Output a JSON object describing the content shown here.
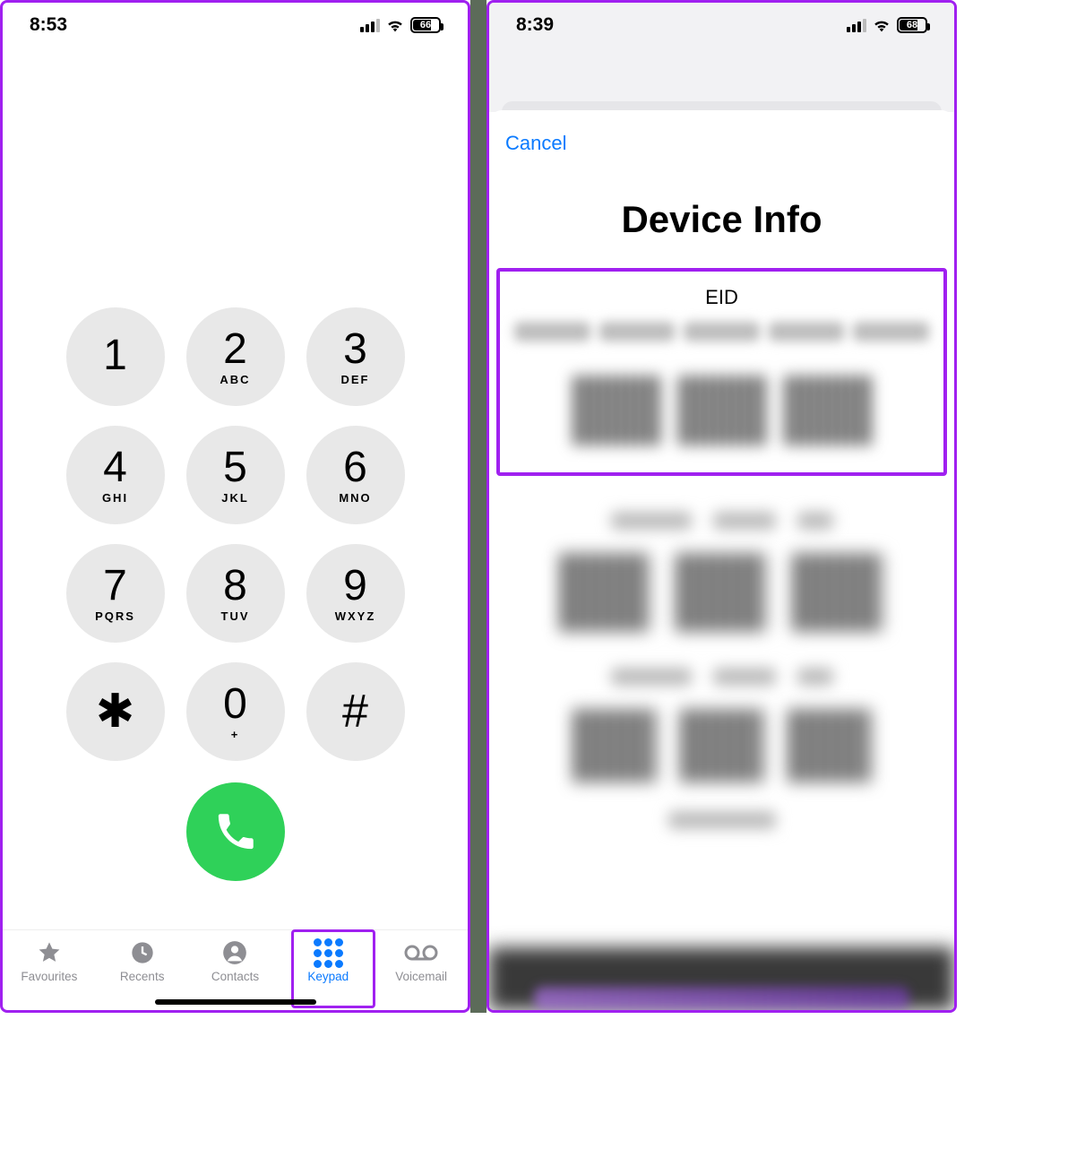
{
  "left": {
    "status": {
      "time": "8:53",
      "battery": "66"
    },
    "keys": [
      {
        "digit": "1",
        "letters": ""
      },
      {
        "digit": "2",
        "letters": "ABC"
      },
      {
        "digit": "3",
        "letters": "DEF"
      },
      {
        "digit": "4",
        "letters": "GHI"
      },
      {
        "digit": "5",
        "letters": "JKL"
      },
      {
        "digit": "6",
        "letters": "MNO"
      },
      {
        "digit": "7",
        "letters": "PQRS"
      },
      {
        "digit": "8",
        "letters": "TUV"
      },
      {
        "digit": "9",
        "letters": "WXYZ"
      },
      {
        "digit": "✱",
        "letters": ""
      },
      {
        "digit": "0",
        "letters": "+"
      },
      {
        "digit": "#",
        "letters": ""
      }
    ],
    "tabs": {
      "favourites": "Favourites",
      "recents": "Recents",
      "contacts": "Contacts",
      "keypad": "Keypad",
      "voicemail": "Voicemail"
    }
  },
  "right": {
    "status": {
      "time": "8:39",
      "battery": "68"
    },
    "cancel": "Cancel",
    "title": "Device Info",
    "eid_label": "EID"
  }
}
